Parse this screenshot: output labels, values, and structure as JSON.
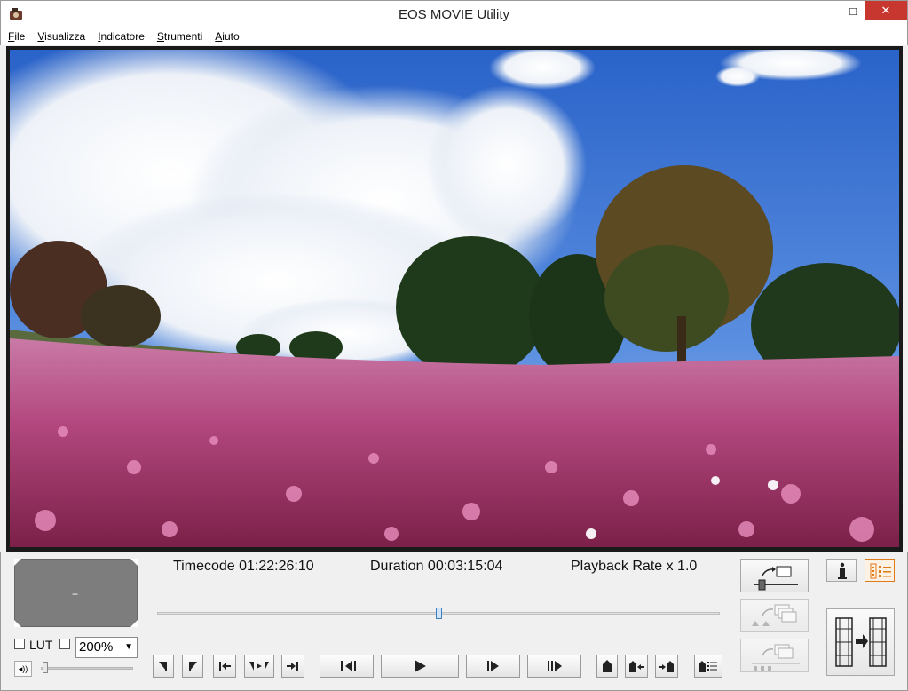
{
  "window": {
    "title": "EOS MOVIE Utility",
    "controls": {
      "minimize": "—",
      "maximize": "□",
      "close": "✕"
    }
  },
  "menu": [
    {
      "label": "File",
      "accel": "F",
      "rest": "ile"
    },
    {
      "label": "Visualizza",
      "accel": "V",
      "rest": "isualizza"
    },
    {
      "label": "Indicatore",
      "accel": "I",
      "rest": "ndicatore"
    },
    {
      "label": "Strumenti",
      "accel": "S",
      "rest": "trumenti"
    },
    {
      "label": "Aiuto",
      "accel": "A",
      "rest": "iuto"
    }
  ],
  "player": {
    "timecode": "Timecode 01:22:26:10",
    "duration": "Duration 00:03:15:04",
    "playback_rate": "Playback Rate x 1.0",
    "seek_position": 0.5
  },
  "panel": {
    "lut_label": "LUT",
    "lut_checked": false,
    "second_checkbox_checked": false,
    "zoom": "200%",
    "volume": 0.02
  },
  "icons": {
    "app": "camera-icon",
    "info": "info-icon",
    "list": "list-icon"
  },
  "colors": {
    "close_button": "#c7372f",
    "seek_thumb": "#3f7fc0",
    "list_button_accent": "#e07b1a"
  }
}
